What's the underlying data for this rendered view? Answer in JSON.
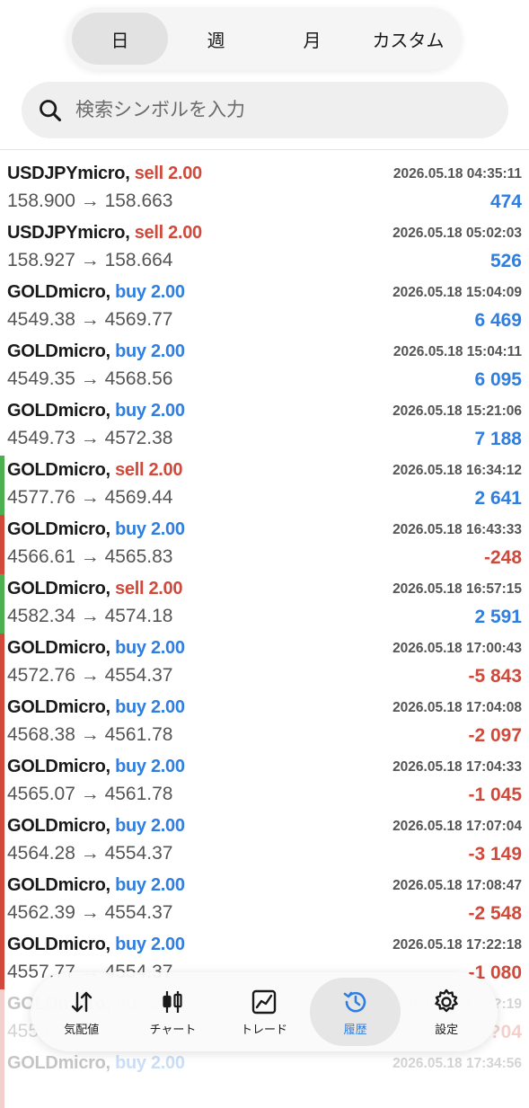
{
  "period_tabs": [
    {
      "label": "日",
      "active": true
    },
    {
      "label": "週",
      "active": false
    },
    {
      "label": "月",
      "active": false
    },
    {
      "label": "カスタム",
      "active": false
    }
  ],
  "search": {
    "placeholder": "検索シンボルを入力"
  },
  "trades": [
    {
      "symbol": "USDJPYmicro,",
      "side": "sell 2.00",
      "time": "2026.05.18 04:35:11",
      "prices": "158.900 → 158.663",
      "profit": "474",
      "marker": ""
    },
    {
      "symbol": "USDJPYmicro,",
      "side": "sell 2.00",
      "time": "2026.05.18 05:02:03",
      "prices": "158.927 → 158.664",
      "profit": "526",
      "marker": ""
    },
    {
      "symbol": "GOLDmicro,",
      "side": "buy 2.00",
      "time": "2026.05.18 15:04:09",
      "prices": "4549.38 → 4569.77",
      "profit": "6 469",
      "marker": ""
    },
    {
      "symbol": "GOLDmicro,",
      "side": "buy 2.00",
      "time": "2026.05.18 15:04:11",
      "prices": "4549.35 → 4568.56",
      "profit": "6 095",
      "marker": ""
    },
    {
      "symbol": "GOLDmicro,",
      "side": "buy 2.00",
      "time": "2026.05.18 15:21:06",
      "prices": "4549.73 → 4572.38",
      "profit": "7 188",
      "marker": ""
    },
    {
      "symbol": "GOLDmicro,",
      "side": "sell 2.00",
      "time": "2026.05.18 16:34:12",
      "prices": "4577.76 → 4569.44",
      "profit": "2 641",
      "marker": "#4caf50"
    },
    {
      "symbol": "GOLDmicro,",
      "side": "buy 2.00",
      "time": "2026.05.18 16:43:33",
      "prices": "4566.61 → 4565.83",
      "profit": "-248",
      "marker": "#d0493a"
    },
    {
      "symbol": "GOLDmicro,",
      "side": "sell 2.00",
      "time": "2026.05.18 16:57:15",
      "prices": "4582.34 → 4574.18",
      "profit": "2 591",
      "marker": "#4caf50"
    },
    {
      "symbol": "GOLDmicro,",
      "side": "buy 2.00",
      "time": "2026.05.18 17:00:43",
      "prices": "4572.76 → 4554.37",
      "profit": "-5 843",
      "marker": "#d0493a"
    },
    {
      "symbol": "GOLDmicro,",
      "side": "buy 2.00",
      "time": "2026.05.18 17:04:08",
      "prices": "4568.38 → 4561.78",
      "profit": "-2 097",
      "marker": "#d0493a"
    },
    {
      "symbol": "GOLDmicro,",
      "side": "buy 2.00",
      "time": "2026.05.18 17:04:33",
      "prices": "4565.07 → 4561.78",
      "profit": "-1 045",
      "marker": "#d0493a"
    },
    {
      "symbol": "GOLDmicro,",
      "side": "buy 2.00",
      "time": "2026.05.18 17:07:04",
      "prices": "4564.28 → 4554.37",
      "profit": "-3 149",
      "marker": "#d0493a"
    },
    {
      "symbol": "GOLDmicro,",
      "side": "buy 2.00",
      "time": "2026.05.18 17:08:47",
      "prices": "4562.39 → 4554.37",
      "profit": "-2 548",
      "marker": "#d0493a"
    },
    {
      "symbol": "GOLDmicro,",
      "side": "buy 2.00",
      "time": "2026.05.18 17:22:18",
      "prices": "4557.77 → 4554.37",
      "profit": "-1 080",
      "marker": "#d0493a"
    },
    {
      "symbol": "GOLDmicro,",
      "side": "buy 2.00",
      "time": "2026.05.18 17:??:19",
      "prices": "4553.?? → 4554.37",
      "profit": "-?04",
      "marker": "#d0493a",
      "faded": true
    },
    {
      "symbol": "GOLDmicro,",
      "side": "buy 2.00",
      "time": "2026.05.18 17:34:56",
      "prices": "",
      "profit": "",
      "marker": "#d0493a",
      "faded": true
    }
  ],
  "nav": [
    {
      "label": "気配値",
      "icon": "arrows-updown-icon",
      "active": false
    },
    {
      "label": "チャート",
      "icon": "candlestick-icon",
      "active": false
    },
    {
      "label": "トレード",
      "icon": "trend-chart-icon",
      "active": false
    },
    {
      "label": "履歴",
      "icon": "history-clock-icon",
      "active": true
    },
    {
      "label": "設定",
      "icon": "gear-icon",
      "active": false
    }
  ],
  "colors": {
    "sell": "#d0493a",
    "buy": "#2f7ee0",
    "profit_positive": "#2f7ee0",
    "profit_negative": "#d0493a",
    "marker_green": "#4caf50",
    "marker_red": "#d0493a"
  }
}
